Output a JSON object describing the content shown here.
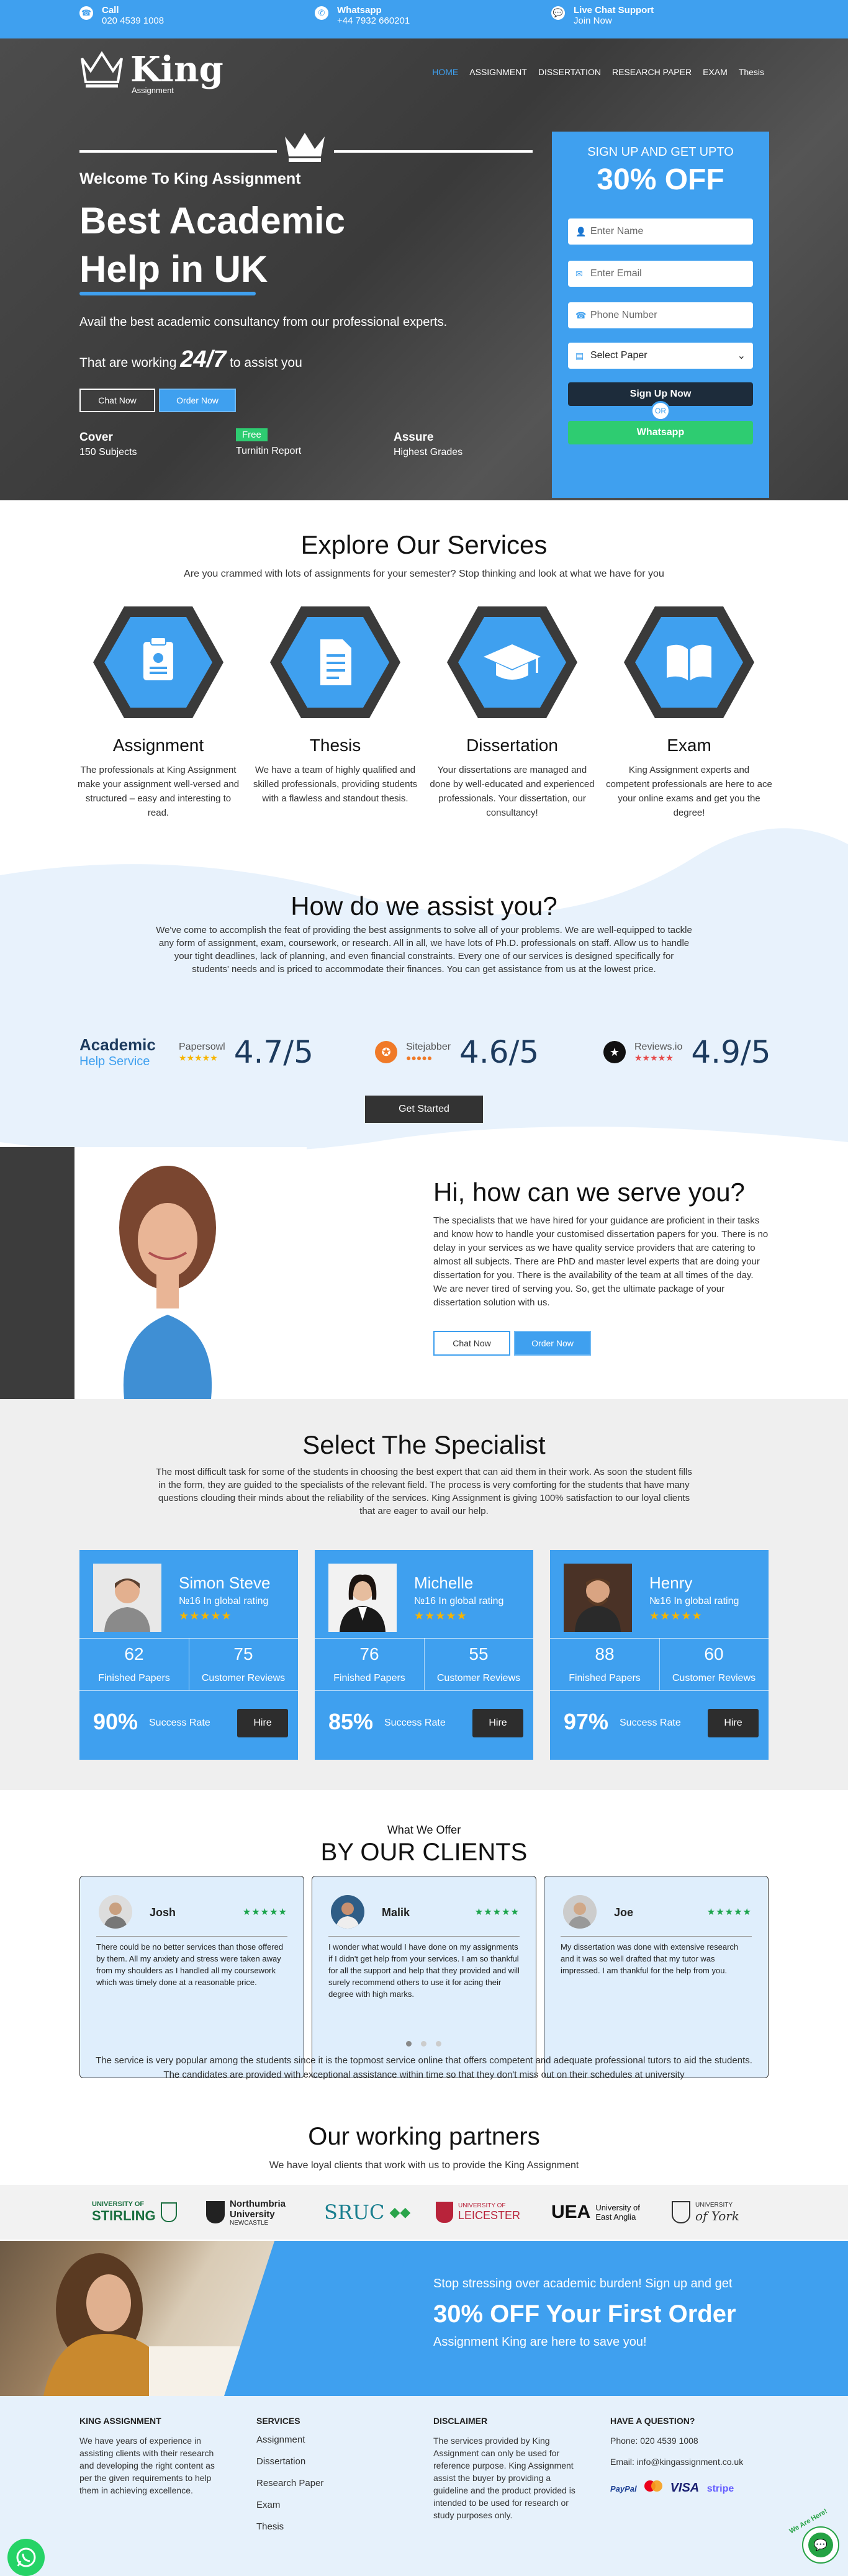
{
  "topbar": {
    "call": {
      "title": "Call",
      "value": "020 4539 1008"
    },
    "whatsapp": {
      "title": "Whatsapp",
      "value": "+44 7932 660201"
    },
    "chat": {
      "title": "Live Chat Support",
      "value": "Join Now"
    }
  },
  "brand": {
    "name": "King",
    "sub": "Assignment"
  },
  "nav": [
    "HOME",
    "ASSIGNMENT",
    "DISSERTATION",
    "RESEARCH PAPER",
    "EXAM",
    "Thesis"
  ],
  "hero": {
    "welcome": "Welcome To King Assignment",
    "title_line1": "Best Academic",
    "title_line2": "Help in UK",
    "lead": "Avail the best academic consultancy from our professional experts.",
    "working_pre": "That are working",
    "working_bold": "24/7",
    "working_post": "to assist you",
    "chat_btn": "Chat Now",
    "order_btn": "Order Now",
    "stats": [
      {
        "title": "Cover",
        "sub": "150 Subjects"
      },
      {
        "title": "Free",
        "sub": "Turnitin Report"
      },
      {
        "title": "Assure",
        "sub": "Highest Grades"
      }
    ]
  },
  "form": {
    "heading": "SIGN UP AND GET UPTO",
    "offer": "30% OFF",
    "name_placeholder": "Enter Name",
    "email_placeholder": "Enter Email",
    "phone_placeholder": "Phone Number",
    "select_value": "Select Paper",
    "signup_btn": "Sign Up Now",
    "or": "OR",
    "whatsapp_btn": "Whatsapp"
  },
  "services": {
    "title": "Explore Our Services",
    "subtitle": "Are you crammed with lots of assignments for your semester? Stop thinking and look at what we have for you",
    "items": [
      {
        "icon": "clipboard-icon",
        "title": "Assignment",
        "text": "The professionals at King Assignment make your assignment well-versed and structured – easy and interesting to read."
      },
      {
        "icon": "document-icon",
        "title": "Thesis",
        "text": "We have a team of highly qualified and skilled professionals, providing students with a flawless and standout thesis."
      },
      {
        "icon": "graduation-cap-icon",
        "title": "Dissertation",
        "text": "Your dissertations are managed and done by well-educated and experienced professionals. Your dissertation, our consultancy!"
      },
      {
        "icon": "open-book-icon",
        "title": "Exam",
        "text": "King Assignment experts and competent professionals are here to ace your online exams and get you the degree!"
      }
    ]
  },
  "assist": {
    "title": "How do we assist you?",
    "text": "We've come to accomplish the feat of providing the best assignments to solve all of your problems. We are well-equipped to tackle any form of assignment, exam, coursework, or research. All in all, we have lots of Ph.D. professionals on staff. Allow us to handle your tight deadlines, lack of planning, and even financial constraints. Every one of our services is designed specifically for students' needs and is priced to accommodate their finances. You can get assistance from us at the lowest price.",
    "academic_logo_1": "Academic",
    "academic_logo_2": "Help Service",
    "ratings": [
      {
        "site": "Papersowl",
        "score": "4.7/5"
      },
      {
        "site": "Sitejabber",
        "score": "4.6/5"
      },
      {
        "site": "Reviews.io",
        "score": "4.9/5"
      }
    ],
    "cta": "Get Started"
  },
  "serve": {
    "title": "Hi, how can we serve you?",
    "text": "The specialists that we have hired for your guidance are proficient in their tasks and know how to handle your customised dissertation papers for you. There is no delay in your services as we have quality service providers that are catering to almost all subjects. There are PhD and master level experts that are doing your dissertation for you. There is the availability of the team at all times of the day. We are never tired of serving you. So, get the ultimate package of your dissertation solution with us.",
    "chat_btn": "Chat Now",
    "order_btn": "Order Now"
  },
  "specialist": {
    "title": "Select The Specialist",
    "text": "The most difficult task for some of the students in choosing the best expert that can aid them in their work. As soon the student fills in the form, they are guided to the specialists of the relevant field. The process is very comforting for the students that have many questions clouding their minds about the reliability of the services. King Assignment is giving 100% satisfaction to our loyal clients that are eager to avail our help.",
    "finished_label": "Finished Papers",
    "reviews_label": "Customer Reviews",
    "success_label": "Success Rate",
    "hire_label": "Hire",
    "cards": [
      {
        "name": "Simon Steve",
        "rank": "№16 In global rating",
        "finished": "62",
        "reviews": "75",
        "success": "90%"
      },
      {
        "name": "Michelle",
        "rank": "№16 In global rating",
        "finished": "76",
        "reviews": "55",
        "success": "85%"
      },
      {
        "name": "Henry",
        "rank": "№16 In global rating",
        "finished": "88",
        "reviews": "60",
        "success": "97%"
      }
    ]
  },
  "testimonials": {
    "kicker": "What We Offer",
    "title": "BY OUR CLIENTS",
    "items": [
      {
        "name": "Josh",
        "text": "There could be no better services than those offered by them. All my anxiety and stress were taken away from my shoulders as I handled all my coursework which was timely done at a reasonable price."
      },
      {
        "name": "Malik",
        "text": "I wonder what would I have done on my assignments if I didn't get help from your services. I am so thankful for all the support and help that they provided and will surely recommend others to use it for acing their degree with high marks."
      },
      {
        "name": "Joe",
        "text": "My dissertation was done with extensive research and it was so well drafted that my tutor was impressed. I am thankful for the help from you."
      }
    ],
    "stars": "★★★★★",
    "footer_text": "The service is very popular among the students since it is the topmost service online that offers competent and adequate professional tutors to aid the students. The candidates are provided with exceptional assistance within time so that they don't miss out on their schedules at university"
  },
  "partners": {
    "title": "Our working partners",
    "subtitle": "We have loyal clients that work with us to provide the King Assignment",
    "logos": [
      {
        "l1": "UNIVERSITY OF",
        "l2": "STIRLING"
      },
      {
        "l1": "Northumbria",
        "l2": "University",
        "l3": "NEWCASTLE"
      },
      {
        "l1": "SRUC"
      },
      {
        "l1": "UNIVERSITY OF",
        "l2": "LEICESTER"
      },
      {
        "l1": "UEA",
        "l2": "University of",
        "l3": "East Anglia"
      },
      {
        "l1": "UNIVERSITY",
        "l2": "of York"
      }
    ]
  },
  "cta": {
    "line1": "Stop stressing over academic burden! Sign up and get",
    "line2": "30% OFF Your First Order",
    "line3": "Assignment King are here to save you!"
  },
  "footer": {
    "about_h": "KING ASSIGNMENT",
    "about_p": "We have years of experience in assisting clients with their research and developing the right content as per the given requirements to help them in achieving excellence.",
    "services_h": "SERVICES",
    "services": [
      "Assignment",
      "Dissertation",
      "Research Paper",
      "Exam",
      "Thesis"
    ],
    "disclaimer_h": "DISCLAIMER",
    "disclaimer_p": "The services provided by King Assignment can only be used for reference purpose. King Assignment assist the buyer by providing a guideline and the product provided is intended to be used for research or study purposes only.",
    "question_h": "HAVE A QUESTION?",
    "phone": "Phone: 020 4539 1008",
    "email": "Email: info@kingassignment.co.uk",
    "payments": [
      "PayPal",
      "VISA",
      "stripe"
    ]
  },
  "chat_widget": "We Are Here!",
  "colors": {
    "accent": "#3fa0ef",
    "dark": "#1d2c3b",
    "green": "#2ecc71",
    "star": "#f7b500"
  }
}
